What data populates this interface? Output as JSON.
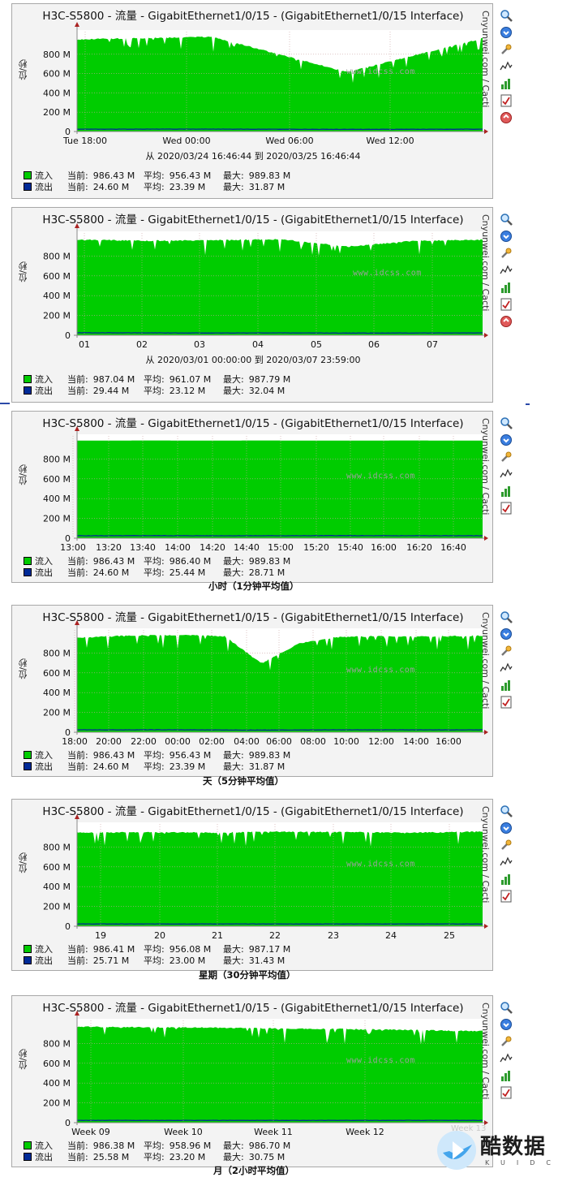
{
  "common": {
    "title": "H3C-S5800 - 流量 - GigabitEthernet1/0/15 - (GigabitEthernet1/0/15 Interface)",
    "vertical_label": "位/秒",
    "side_label": "Cnyunwei.com / Cacti",
    "watermark": "www.idcss.com",
    "legend_in": "流入",
    "legend_out": "流出",
    "lbl_current": "当前:",
    "lbl_average": "平均:",
    "lbl_max": "最大:",
    "color_in": "#00cc00",
    "color_out": "#002a97",
    "y_ticks": [
      "0",
      "200 M",
      "400 M",
      "600 M",
      "800 M"
    ],
    "icons": [
      "zoom-icon",
      "export-icon",
      "properties-icon",
      "graph-icon",
      "bar-icon",
      "report-icon",
      "close-icon"
    ]
  },
  "graphs": [
    {
      "x_ticks": [
        "Tue 18:00",
        "Wed 00:00",
        "Wed 06:00",
        "Wed 12:00"
      ],
      "range": "从 2020/03/24 16:46:44 到 2020/03/25 16:46:44",
      "caption": "",
      "in": {
        "current": "986.43 M",
        "average": "956.43 M",
        "max": "989.83 M"
      },
      "out": {
        "current": "24.60 M",
        "average": "23.39 M",
        "max": "31.87 M"
      }
    },
    {
      "x_ticks": [
        "01",
        "02",
        "03",
        "04",
        "05",
        "06",
        "07"
      ],
      "range": "从 2020/03/01 00:00:00 到 2020/03/07 23:59:00",
      "caption": "",
      "in": {
        "current": "987.04 M",
        "average": "961.07 M",
        "max": "987.79 M"
      },
      "out": {
        "current": "29.44 M",
        "average": "23.12 M",
        "max": "32.04 M"
      }
    },
    {
      "x_ticks": [
        "13:00",
        "13:20",
        "13:40",
        "14:00",
        "14:20",
        "14:40",
        "15:00",
        "15:20",
        "15:40",
        "16:00",
        "16:20",
        "16:40"
      ],
      "range": "",
      "caption": "小时（1分钟平均值）",
      "in": {
        "current": "986.43 M",
        "average": "986.40 M",
        "max": "989.83 M"
      },
      "out": {
        "current": "24.60 M",
        "average": "25.44 M",
        "max": "28.71 M"
      }
    },
    {
      "x_ticks": [
        "18:00",
        "20:00",
        "22:00",
        "00:00",
        "02:00",
        "04:00",
        "06:00",
        "08:00",
        "10:00",
        "12:00",
        "14:00",
        "16:00"
      ],
      "range": "",
      "caption": "天（5分钟平均值）",
      "in": {
        "current": "986.43 M",
        "average": "956.43 M",
        "max": "989.83 M"
      },
      "out": {
        "current": "24.60 M",
        "average": "23.39 M",
        "max": "31.87 M"
      }
    },
    {
      "x_ticks": [
        "19",
        "20",
        "21",
        "22",
        "23",
        "24",
        "25"
      ],
      "range": "",
      "caption": "星期（30分钟平均值）",
      "in": {
        "current": "986.41 M",
        "average": "956.08 M",
        "max": "987.17 M"
      },
      "out": {
        "current": "25.71 M",
        "average": "23.00 M",
        "max": "31.43 M"
      }
    },
    {
      "x_ticks": [
        "Week 09",
        "Week 10",
        "Week 11",
        "Week 12"
      ],
      "range": "",
      "caption": "月（2小时平均值）",
      "in": {
        "current": "986.38 M",
        "average": "958.96 M",
        "max": "986.70 M"
      },
      "out": {
        "current": "25.58 M",
        "average": "23.20 M",
        "max": "30.75 M"
      }
    }
  ],
  "chart_data": [
    {
      "type": "area",
      "ylabel": "位/秒",
      "ylim": [
        0,
        1000000000
      ],
      "categories": [
        "Tue 18:00",
        "Wed 00:00",
        "Wed 06:00",
        "Wed 12:00"
      ],
      "series": [
        {
          "name": "流入",
          "values": [
            960,
            985,
            620,
            970
          ]
        },
        {
          "name": "流出",
          "values": [
            24,
            25,
            22,
            24
          ]
        }
      ]
    },
    {
      "type": "area",
      "ylabel": "位/秒",
      "ylim": [
        0,
        1000000000
      ],
      "categories": [
        "01",
        "02",
        "03",
        "04",
        "05",
        "06",
        "07"
      ],
      "series": [
        {
          "name": "流入",
          "values": [
            970,
            960,
            965,
            975,
            900,
            960,
            970
          ]
        },
        {
          "name": "流出",
          "values": [
            25,
            24,
            23,
            24,
            22,
            23,
            24
          ]
        }
      ]
    },
    {
      "type": "area",
      "ylabel": "位/秒",
      "ylim": [
        0,
        1000000000
      ],
      "categories": [
        "13:00",
        "13:20",
        "13:40",
        "14:00",
        "14:20",
        "14:40",
        "15:00",
        "15:20",
        "15:40",
        "16:00",
        "16:20",
        "16:40"
      ],
      "series": [
        {
          "name": "流入",
          "values": [
            986,
            986,
            987,
            986,
            986,
            987,
            986,
            986,
            986,
            987,
            986,
            986
          ]
        },
        {
          "name": "流出",
          "values": [
            25,
            25,
            26,
            25,
            25,
            25,
            25,
            26,
            25,
            25,
            25,
            25
          ]
        }
      ]
    },
    {
      "type": "area",
      "ylabel": "位/秒",
      "ylim": [
        0,
        1000000000
      ],
      "categories": [
        "18:00",
        "20:00",
        "22:00",
        "00:00",
        "02:00",
        "04:00",
        "06:00",
        "08:00",
        "10:00",
        "12:00",
        "14:00",
        "16:00"
      ],
      "series": [
        {
          "name": "流入",
          "values": [
            960,
            975,
            985,
            985,
            975,
            700,
            900,
            965,
            975,
            970,
            975,
            980
          ]
        },
        {
          "name": "流出",
          "values": [
            24,
            24,
            25,
            24,
            23,
            21,
            23,
            24,
            24,
            24,
            24,
            24
          ]
        }
      ]
    },
    {
      "type": "area",
      "ylabel": "位/秒",
      "ylim": [
        0,
        1000000000
      ],
      "categories": [
        "19",
        "20",
        "21",
        "22",
        "23",
        "24",
        "25"
      ],
      "series": [
        {
          "name": "流入",
          "values": [
            950,
            955,
            950,
            960,
            955,
            950,
            960
          ]
        },
        {
          "name": "流出",
          "values": [
            23,
            23,
            23,
            23,
            23,
            23,
            23
          ]
        }
      ]
    },
    {
      "type": "area",
      "ylabel": "位/秒",
      "ylim": [
        0,
        1000000000
      ],
      "categories": [
        "Week 09",
        "Week 10",
        "Week 11",
        "Week 12"
      ],
      "series": [
        {
          "name": "流入",
          "values": [
            975,
            965,
            950,
            930
          ]
        },
        {
          "name": "流出",
          "values": [
            23,
            23,
            23,
            23
          ]
        }
      ]
    }
  ]
}
